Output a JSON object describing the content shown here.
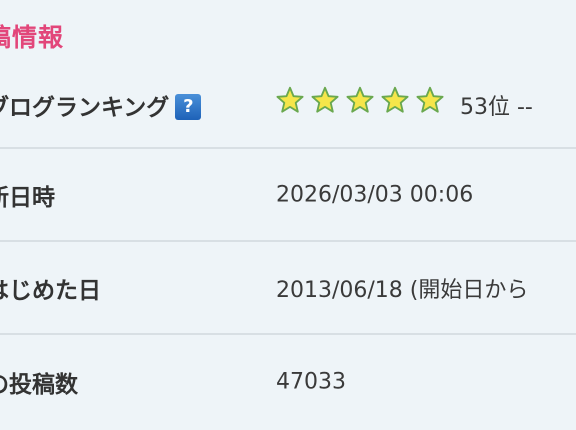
{
  "section": {
    "title": "稿情報"
  },
  "rows": [
    {
      "label": "ブログランキング",
      "help_label": "?",
      "stars": {
        "count": 5,
        "icon": "star-icon",
        "fill_color": "#f5e64a",
        "outline_color": "#6aa84f"
      },
      "value": "53位 --"
    },
    {
      "label": "新日時",
      "value": "2026/03/03 00:06"
    },
    {
      "label": "はじめた日",
      "value": "2013/06/18 (開始日から"
    },
    {
      "label": "の投稿数",
      "value": "47033"
    }
  ],
  "colors": {
    "title": "#e2467a",
    "background": "#eef4f8",
    "divider": "#d8dfe4",
    "help_icon": "#2a72c8"
  }
}
